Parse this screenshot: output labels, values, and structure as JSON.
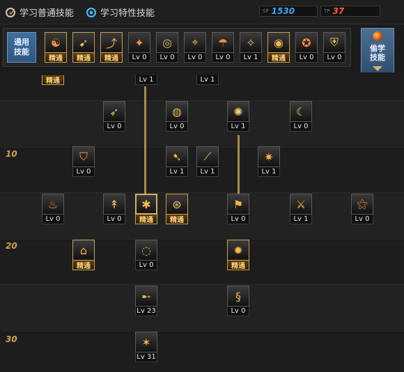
{
  "tabs": {
    "normal": "学习普通技能",
    "special": "学习特性技能"
  },
  "sp": {
    "blue_tag": "SP",
    "blue_value": "1530",
    "red_tag": "TP",
    "red_value": "37"
  },
  "quickbar": {
    "general_label_line1": "通用",
    "general_label_line2": "技能",
    "skills": [
      {
        "label": "精通",
        "mastered": true,
        "icon": "meditation-icon"
      },
      {
        "label": "精通",
        "mastered": true,
        "icon": "dash-icon"
      },
      {
        "label": "精通",
        "mastered": true,
        "icon": "leap-icon"
      },
      {
        "label": "Lv 0",
        "mastered": false,
        "icon": "wings-icon"
      },
      {
        "label": "Lv 0",
        "mastered": false,
        "icon": "target-icon"
      },
      {
        "label": "Lv 0",
        "mastered": false,
        "icon": "reticle-icon"
      },
      {
        "label": "Lv 0",
        "mastered": false,
        "icon": "mushroom-icon"
      },
      {
        "label": "Lv 1",
        "mastered": false,
        "icon": "spirit-icon"
      },
      {
        "label": "精通",
        "mastered": true,
        "icon": "eye-icon"
      },
      {
        "label": "Lv 0",
        "mastered": false,
        "icon": "power-icon"
      },
      {
        "label": "Lv 0",
        "mastered": false,
        "icon": "guard-icon"
      }
    ]
  },
  "side_button": {
    "line1": "偷学",
    "line2": "技能"
  },
  "levels": [
    "10",
    "20",
    "30"
  ],
  "tree": {
    "top_partial": [
      {
        "label": "精通",
        "mastered": true
      },
      {
        "label": "Lv 1",
        "mastered": false
      },
      {
        "label": "Lv 1",
        "mastered": false
      }
    ],
    "row1": [
      {
        "label": "Lv 0",
        "icon": "strike-icon"
      },
      {
        "label": "Lv 0",
        "icon": "orb-icon"
      },
      {
        "label": "Lv 1",
        "icon": "spark-icon"
      },
      {
        "label": "Lv 0",
        "icon": "crescent-icon"
      }
    ],
    "row2": [
      {
        "label": "Lv 0",
        "icon": "shield-icon"
      },
      {
        "label": "Lv 1",
        "icon": "kick-icon"
      },
      {
        "label": "Lv 1",
        "icon": "slash-icon"
      },
      {
        "label": "Lv 1",
        "icon": "burst-icon"
      }
    ],
    "row3": [
      {
        "label": "Lv 0",
        "icon": "flame-icon",
        "mastered": false
      },
      {
        "label": "Lv 0",
        "icon": "uppercut-icon",
        "mastered": false
      },
      {
        "label": "精通",
        "icon": "wind-icon",
        "mastered": true
      },
      {
        "label": "精通",
        "icon": "sigil-icon",
        "mastered": true
      },
      {
        "label": "Lv 0",
        "icon": "flag-icon",
        "mastered": false
      },
      {
        "label": "Lv 1",
        "icon": "warrior-icon",
        "mastered": false
      },
      {
        "label": "Lv 0",
        "icon": "fire-claw-icon",
        "mastered": false
      }
    ],
    "row4": [
      {
        "label": "精通",
        "icon": "pillar-icon",
        "mastered": true
      },
      {
        "label": "Lv 0",
        "icon": "vortex-icon",
        "mastered": false
      },
      {
        "label": "精通",
        "icon": "blaze-icon",
        "mastered": true
      }
    ],
    "row5": [
      {
        "label": "Lv 23",
        "icon": "spear-icon"
      },
      {
        "label": "Lv 0",
        "icon": "spring-icon"
      }
    ],
    "row6": [
      {
        "label": "Lv 31",
        "icon": "inferno-icon"
      }
    ]
  },
  "colors": {
    "gold": "#caa04a",
    "sp_blue": "#3aa7ff",
    "tp_red": "#ff5a3c",
    "level_text": "#d6a34a"
  }
}
